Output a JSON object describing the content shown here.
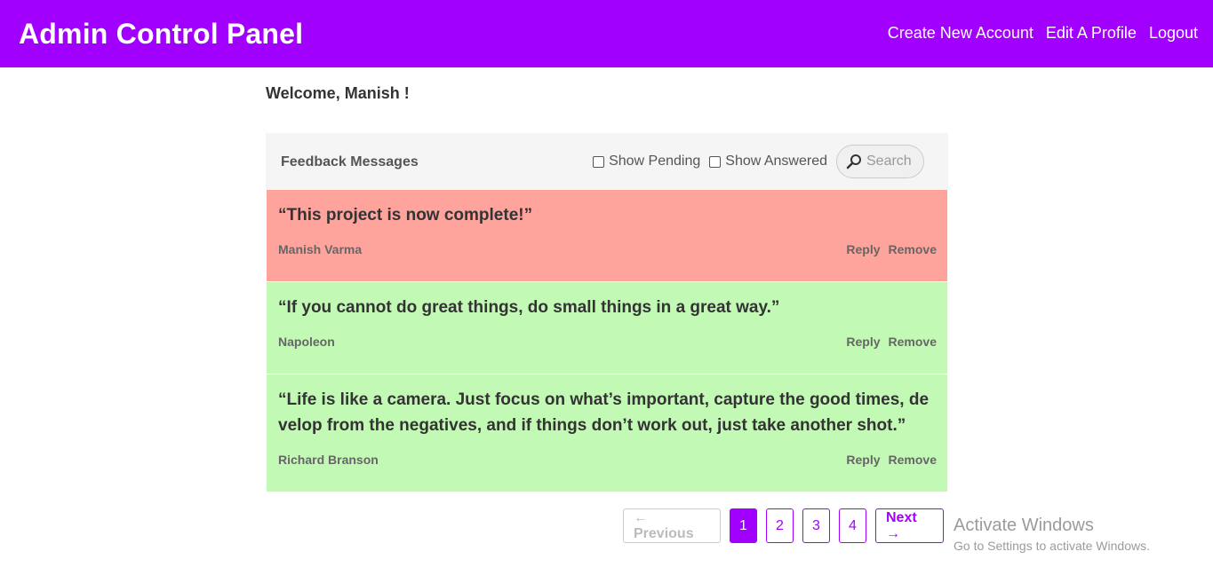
{
  "header": {
    "title": "Admin Control Panel",
    "nav": [
      "Create New Account",
      "Edit A Profile",
      "Logout"
    ],
    "color": "#a100ff"
  },
  "welcome": "Welcome, Manish !",
  "panel": {
    "title": "Feedback Messages",
    "filters": [
      "Show Pending",
      "Show Answered"
    ],
    "search_placeholder": "Search"
  },
  "messages": [
    {
      "text": "“This project is now complete!”",
      "author": "Manish Varma",
      "status": "pending",
      "reply": "Reply",
      "remove": "Remove"
    },
    {
      "text": "“If you cannot do great things, do small things in a great way.”",
      "author": "Napoleon",
      "status": "answered",
      "reply": "Reply",
      "remove": "Remove"
    },
    {
      "text": "“Life is like a camera. Just focus on what’s important, capture the good times, develop from the negatives, and if things don’t work out, just take another shot.”",
      "author": "Richard Branson",
      "status": "answered",
      "reply": "Reply",
      "remove": "Remove"
    }
  ],
  "pagination": {
    "previous": "← Previous",
    "pages": [
      "1",
      "2",
      "3",
      "4"
    ],
    "active": "1",
    "next": "Next →"
  },
  "watermark": {
    "line1": "Activate Windows",
    "line2": "Go to Settings to activate Windows."
  },
  "colors": {
    "pending": "#ffa49d",
    "answered": "#c2f9b5",
    "accent": "#a100ff"
  }
}
